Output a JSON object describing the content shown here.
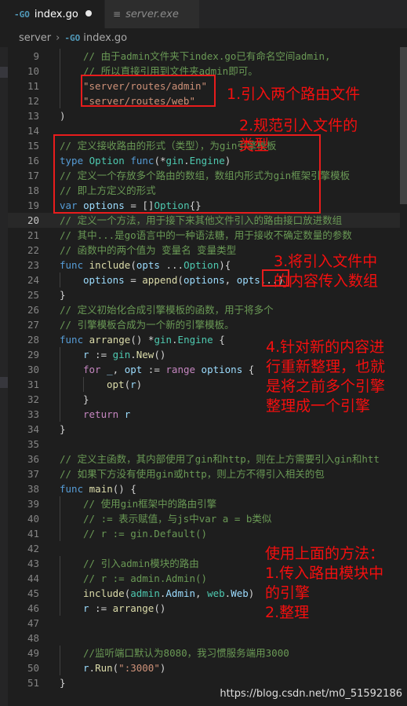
{
  "tabs": [
    {
      "label": "index.go",
      "icon": "go-icon",
      "modified": true
    },
    {
      "label": "server.exe",
      "icon": "file-icon",
      "modified": false
    }
  ],
  "breadcrumb": {
    "folder": "server",
    "file": "index.go"
  },
  "current_line": "20",
  "lines": [
    {
      "n": "9",
      "indent": 1,
      "tokens": [
        [
          "c",
          "// 由于admin文件夹下index.go已有命名空间admin,"
        ]
      ]
    },
    {
      "n": "10",
      "indent": 1,
      "tokens": [
        [
          "c",
          "// 所以直接引用到文件夹admin即可。"
        ]
      ]
    },
    {
      "n": "11",
      "indent": 1,
      "tokens": [
        [
          "s",
          "\"server/routes/admin\""
        ]
      ]
    },
    {
      "n": "12",
      "indent": 1,
      "tokens": [
        [
          "s",
          "\"server/routes/web\""
        ]
      ]
    },
    {
      "n": "13",
      "indent": 0,
      "tokens": [
        [
          "p",
          ")"
        ]
      ]
    },
    {
      "n": "14",
      "indent": 0,
      "tokens": []
    },
    {
      "n": "15",
      "indent": 0,
      "tokens": [
        [
          "c",
          "// 定义接收路由的形式（类型），为gin引擎模板"
        ]
      ]
    },
    {
      "n": "16",
      "indent": 0,
      "tokens": [
        [
          "k",
          "type "
        ],
        [
          "t",
          "Option "
        ],
        [
          "k",
          "func"
        ],
        [
          "p",
          "(*"
        ],
        [
          "t",
          "gin"
        ],
        [
          "p",
          "."
        ],
        [
          "t",
          "Engine"
        ],
        [
          "p",
          ")"
        ]
      ]
    },
    {
      "n": "17",
      "indent": 0,
      "tokens": [
        [
          "c",
          "// 定义一个存放多个路由的数组，数组内形式为gin框架引擎模板"
        ]
      ]
    },
    {
      "n": "18",
      "indent": 0,
      "tokens": [
        [
          "c",
          "// 即上方定义的形式"
        ]
      ]
    },
    {
      "n": "19",
      "indent": 0,
      "tokens": [
        [
          "k",
          "var "
        ],
        [
          "v",
          "options"
        ],
        [
          "p",
          " = []"
        ],
        [
          "t",
          "Option"
        ],
        [
          "p",
          "{}"
        ]
      ]
    },
    {
      "n": "20",
      "indent": 0,
      "tokens": [
        [
          "c",
          "// 定义一个方法，用于接下来其他文件引入的路由接口放进数组"
        ]
      ]
    },
    {
      "n": "21",
      "indent": 0,
      "tokens": [
        [
          "c",
          "// 其中...是go语言中的一种语法糖，用于接收不确定数量的参数"
        ]
      ]
    },
    {
      "n": "22",
      "indent": 0,
      "tokens": [
        [
          "c",
          "// 函数中的两个值为 变量名 变量类型"
        ]
      ]
    },
    {
      "n": "23",
      "indent": 0,
      "tokens": [
        [
          "k",
          "func "
        ],
        [
          "f",
          "include"
        ],
        [
          "p",
          "("
        ],
        [
          "v",
          "opts"
        ],
        [
          "p",
          " ..."
        ],
        [
          "t",
          "Option"
        ],
        [
          "p",
          "){"
        ]
      ]
    },
    {
      "n": "24",
      "indent": 1,
      "tokens": [
        [
          "v",
          "options"
        ],
        [
          "p",
          " = "
        ],
        [
          "f",
          "append"
        ],
        [
          "p",
          "("
        ],
        [
          "v",
          "options"
        ],
        [
          "p",
          ", "
        ],
        [
          "v",
          "opts"
        ],
        [
          "p",
          "...)"
        ]
      ]
    },
    {
      "n": "25",
      "indent": 0,
      "tokens": [
        [
          "p",
          "}"
        ]
      ]
    },
    {
      "n": "26",
      "indent": 0,
      "tokens": [
        [
          "c",
          "// 定义初始化合成引擎模板的函数，用于将多个"
        ]
      ]
    },
    {
      "n": "27",
      "indent": 0,
      "tokens": [
        [
          "c",
          "// 引擎模板合成为一个新的引擎模板。"
        ]
      ]
    },
    {
      "n": "28",
      "indent": 0,
      "tokens": [
        [
          "k",
          "func "
        ],
        [
          "f",
          "arrange"
        ],
        [
          "p",
          "() *"
        ],
        [
          "t",
          "gin"
        ],
        [
          "p",
          "."
        ],
        [
          "t",
          "Engine"
        ],
        [
          "p",
          " {"
        ]
      ]
    },
    {
      "n": "29",
      "indent": 1,
      "tokens": [
        [
          "v",
          "r"
        ],
        [
          "p",
          " := "
        ],
        [
          "t",
          "gin"
        ],
        [
          "p",
          "."
        ],
        [
          "f",
          "New"
        ],
        [
          "p",
          "()"
        ]
      ]
    },
    {
      "n": "30",
      "indent": 1,
      "tokens": [
        [
          "kc",
          "for "
        ],
        [
          "v",
          "_"
        ],
        [
          "p",
          ", "
        ],
        [
          "v",
          "opt"
        ],
        [
          "p",
          " := "
        ],
        [
          "kc",
          "range "
        ],
        [
          "v",
          "options"
        ],
        [
          "p",
          " {"
        ]
      ]
    },
    {
      "n": "31",
      "indent": 2,
      "tokens": [
        [
          "f",
          "opt"
        ],
        [
          "p",
          "("
        ],
        [
          "v",
          "r"
        ],
        [
          "p",
          ")"
        ]
      ]
    },
    {
      "n": "32",
      "indent": 1,
      "tokens": [
        [
          "p",
          "}"
        ]
      ]
    },
    {
      "n": "33",
      "indent": 1,
      "tokens": [
        [
          "kc",
          "return "
        ],
        [
          "v",
          "r"
        ]
      ]
    },
    {
      "n": "34",
      "indent": 0,
      "tokens": [
        [
          "p",
          "}"
        ]
      ]
    },
    {
      "n": "35",
      "indent": 0,
      "tokens": []
    },
    {
      "n": "36",
      "indent": 0,
      "tokens": [
        [
          "c",
          "// 定义主函数，其内部使用了gin和http，则在上方需要引入gin和htt"
        ]
      ]
    },
    {
      "n": "37",
      "indent": 0,
      "tokens": [
        [
          "c",
          "// 如果下方没有使用gin或http，则上方不得引入相关的包"
        ]
      ]
    },
    {
      "n": "38",
      "indent": 0,
      "tokens": [
        [
          "k",
          "func "
        ],
        [
          "f",
          "main"
        ],
        [
          "p",
          "() {"
        ]
      ]
    },
    {
      "n": "39",
      "indent": 1,
      "tokens": [
        [
          "c",
          "// 使用gin框架中的路由引擎"
        ]
      ]
    },
    {
      "n": "40",
      "indent": 1,
      "tokens": [
        [
          "c",
          "// := 表示赋值，与js中var a = b类似"
        ]
      ]
    },
    {
      "n": "41",
      "indent": 1,
      "tokens": [
        [
          "c",
          "// r := gin.Default()"
        ]
      ]
    },
    {
      "n": "42",
      "indent": 0,
      "tokens": []
    },
    {
      "n": "43",
      "indent": 1,
      "tokens": [
        [
          "c",
          "// 引入admin模块的路由"
        ]
      ]
    },
    {
      "n": "44",
      "indent": 1,
      "tokens": [
        [
          "c",
          "// r := admin.Admin()"
        ]
      ]
    },
    {
      "n": "45",
      "indent": 1,
      "tokens": [
        [
          "f",
          "include"
        ],
        [
          "p",
          "("
        ],
        [
          "t",
          "admin"
        ],
        [
          "p",
          "."
        ],
        [
          "v",
          "Admin"
        ],
        [
          "p",
          ", "
        ],
        [
          "t",
          "web"
        ],
        [
          "p",
          "."
        ],
        [
          "v",
          "Web"
        ],
        [
          "p",
          ")"
        ]
      ]
    },
    {
      "n": "46",
      "indent": 1,
      "tokens": [
        [
          "v",
          "r"
        ],
        [
          "p",
          " := "
        ],
        [
          "f",
          "arrange"
        ],
        [
          "p",
          "()"
        ]
      ]
    },
    {
      "n": "47",
      "indent": 0,
      "tokens": []
    },
    {
      "n": "48",
      "indent": 0,
      "tokens": []
    },
    {
      "n": "49",
      "indent": 1,
      "tokens": [
        [
          "c",
          "//监听端口默认为8080，我习惯服务端用3000"
        ]
      ]
    },
    {
      "n": "50",
      "indent": 1,
      "tokens": [
        [
          "v",
          "r"
        ],
        [
          "p",
          "."
        ],
        [
          "f",
          "Run"
        ],
        [
          "p",
          "("
        ],
        [
          "s",
          "\":3000\""
        ],
        [
          "p",
          ")"
        ]
      ]
    },
    {
      "n": "51",
      "indent": 0,
      "tokens": [
        [
          "p",
          "}"
        ]
      ]
    }
  ],
  "annotations": {
    "a1": "1.引入两个路由文件",
    "a2": "2.规范引入文件的\n类型",
    "a3": "3.将引入文件中\n的内容传入数组",
    "a4": "4.针对新的内容进\n行重新整理，也就\n是将之前多个引擎\n整理成一个引擎",
    "a5": "使用上面的方法：\n1.传入路由模块中\n的引擎\n2.整理"
  },
  "watermark": "https://blog.csdn.net/m0_51592186",
  "colors": {
    "annotation": "#f40f0f",
    "box": "#e81c1c",
    "comment": "#6a9955",
    "keyword": "#569cd6"
  }
}
